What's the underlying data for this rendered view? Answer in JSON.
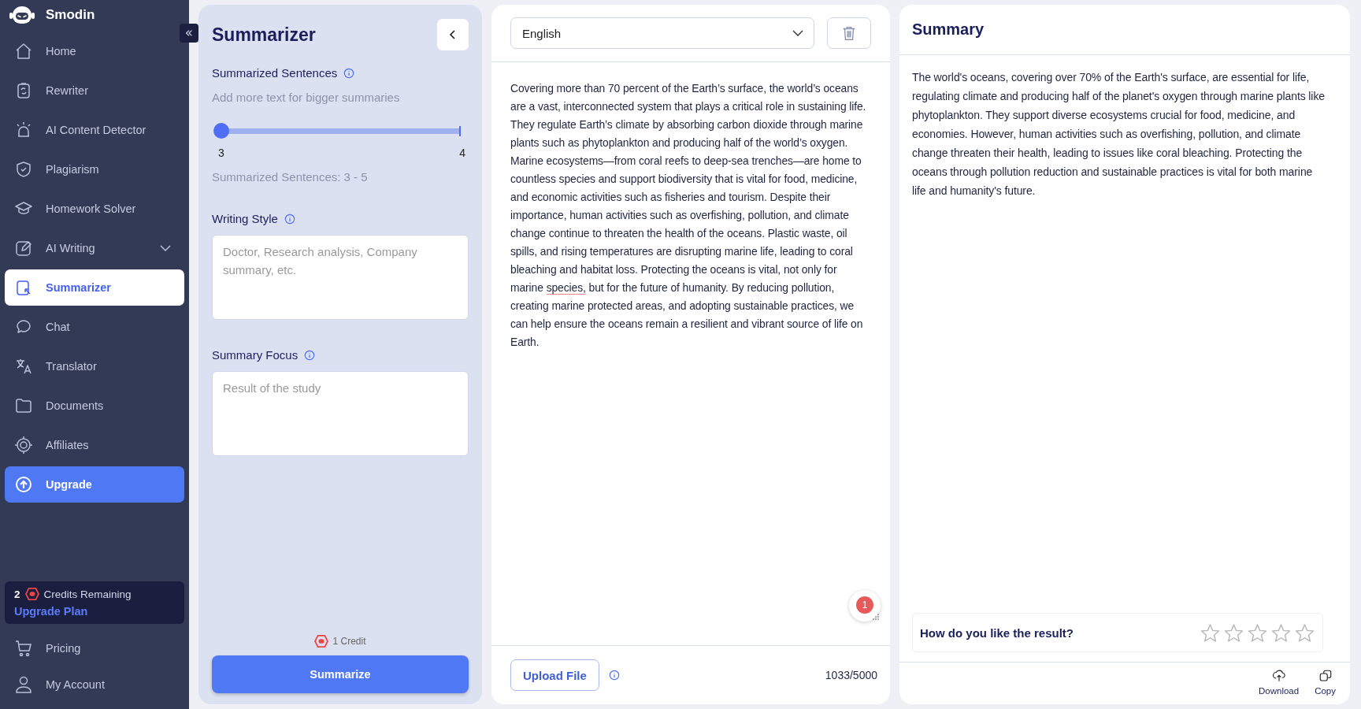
{
  "sidebar": {
    "brand": "Smodin",
    "items": [
      {
        "label": "Home",
        "kind": "nav",
        "selected": false
      },
      {
        "label": "Rewriter",
        "kind": "nav",
        "selected": false
      },
      {
        "label": "AI Content Detector",
        "kind": "nav",
        "selected": false
      },
      {
        "label": "Plagiarism",
        "kind": "nav",
        "selected": false
      },
      {
        "label": "Homework Solver",
        "kind": "nav",
        "selected": false
      },
      {
        "label": "AI Writing",
        "kind": "group",
        "selected": false,
        "expanded": false
      },
      {
        "label": "Summarizer",
        "kind": "nav",
        "selected": true
      },
      {
        "label": "Chat",
        "kind": "nav",
        "selected": false
      },
      {
        "label": "Translator",
        "kind": "nav",
        "selected": false
      },
      {
        "label": "Documents",
        "kind": "nav",
        "selected": false
      },
      {
        "label": "Affiliates",
        "kind": "nav",
        "selected": false
      },
      {
        "label": "Upgrade",
        "kind": "upgrade",
        "selected": false
      }
    ],
    "credits": {
      "count": "2",
      "label": "Credits Remaining",
      "link": "Upgrade Plan"
    },
    "bottom_items": [
      {
        "label": "Pricing"
      },
      {
        "label": "My Account"
      }
    ]
  },
  "settings": {
    "title": "Summarizer",
    "sentences": {
      "label": "Summarized Sentences",
      "hint": "Add more text for bigger summaries",
      "level": 0,
      "min": "3",
      "max": "4",
      "range": "Summarized Sentences: 3 - 5"
    },
    "style": {
      "label": "Writing Style",
      "placeholder": "Doctor, Research analysis, Company summary, etc."
    },
    "focus": {
      "label": "Summary Focus",
      "placeholder": "Result of the study"
    },
    "cost": "1 Credit",
    "button": "Summarize"
  },
  "editor": {
    "language": "English",
    "text": [
      {
        "text": "Covering more than 70 percent of the Earth’s surface, the world’s oceans are a vast, interconnected system that plays a critical role in sustaining life. They regulate Earth’s climate by absorbing carbon dioxide through marine plants such as phytoplankton and producing half of the world’s oxygen. Marine ecosystems—from coral reefs to deep-sea trenches—are home to countless species and support biodiversity that is vital for food, medicine, and economic activities such as fisheries and tourism. Despite their importance, human activities such as overfishing, pollution, and climate change continue to threaten the health of the oceans. Plastic waste, oil spills, and rising temperatures are disrupting marine life, leading to coral bleaching and habitat loss. Protecting the oceans is vital, not only for marine ",
        "flagged": false
      },
      {
        "text": "species,",
        "flagged": true
      },
      {
        "text": " but for the future of humanity. By reducing pollution, creating marine protected areas, and adopting sustainable practices, we can help ensure the oceans remain a resilient and vibrant source of life on Earth.",
        "flagged": false
      }
    ],
    "issues": "1",
    "upload": "Upload File",
    "count": "1033/5000"
  },
  "summary": {
    "title": "Summary",
    "text": "The world's oceans, covering over 70% of the Earth's surface, are essential for life, regulating climate and producing half of the planet's oxygen through marine plants like phytoplankton. They support diverse ecosystems crucial for food, medicine, and economies. However, human activities such as overfishing, pollution, and climate change threaten their health, leading to issues like coral bleaching. Protecting the oceans through pollution reduction and sustainable practices is vital for both marine life and humanity's future.",
    "feedback": {
      "question": "How do you like the result?",
      "stars": 0
    },
    "actions": [
      {
        "label": "Download",
        "kind": "download"
      },
      {
        "label": "Copy",
        "kind": "copy"
      }
    ]
  }
}
